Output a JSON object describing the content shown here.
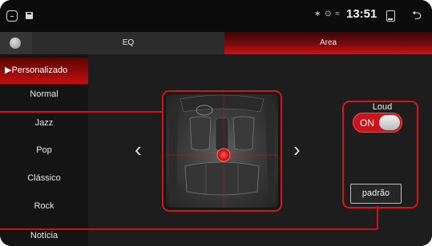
{
  "status_bar": {
    "time": "13:51",
    "indicators": "∗ ⊙ ≈"
  },
  "tabs": [
    {
      "label": "EQ",
      "active": false
    },
    {
      "label": "Area",
      "active": true
    }
  ],
  "presets": [
    {
      "label": "Personalizado",
      "active": true,
      "marker": "▶"
    },
    {
      "label": "Normal",
      "active": false
    },
    {
      "label": "Jazz",
      "active": false
    },
    {
      "label": "Pop",
      "active": false
    },
    {
      "label": "Clássico",
      "active": false
    },
    {
      "label": "Rock",
      "active": false
    },
    {
      "label": "Notícia",
      "active": false
    }
  ],
  "area": {
    "prev_arrow": "‹",
    "next_arrow": "›"
  },
  "loud": {
    "label": "Loud",
    "toggle_text": "ON",
    "is_on": true
  },
  "default_button": "padrão",
  "colors": {
    "accent": "#d3161c",
    "background": "#0c0c0c",
    "panel": "#1d1d1d"
  }
}
